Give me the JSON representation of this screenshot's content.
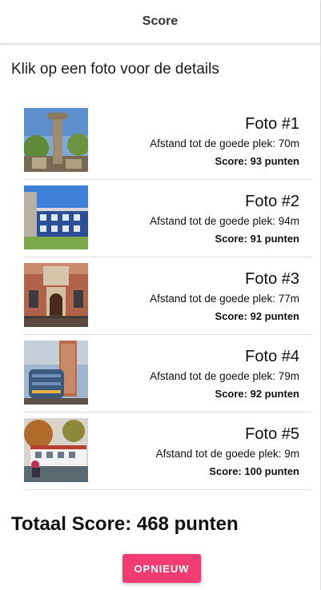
{
  "header": {
    "title": "Score"
  },
  "intro": "Klik op een foto voor de details",
  "photos": [
    {
      "title": "Foto #1",
      "distance": "Afstand tot de goede plek: 70m",
      "score": "Score: 93 punten",
      "thumb_icon": "statue-photo"
    },
    {
      "title": "Foto #2",
      "distance": "Afstand tot de goede plek: 94m",
      "score": "Score: 91 punten",
      "thumb_icon": "blue-building-photo"
    },
    {
      "title": "Foto #3",
      "distance": "Afstand tot de goede plek: 77m",
      "score": "Score: 92 punten",
      "thumb_icon": "brick-facade-photo"
    },
    {
      "title": "Foto #4",
      "distance": "Afstand tot de goede plek: 79m",
      "score": "Score: 92 punten",
      "thumb_icon": "glass-tower-photo"
    },
    {
      "title": "Foto #5",
      "distance": "Afstand tot de goede plek: 9m",
      "score": "Score: 100 punten",
      "thumb_icon": "houseboat-photo"
    }
  ],
  "total": "Totaal Score: 468 punten",
  "restart_label": "OPNIEUW",
  "colors": {
    "accent": "#f03c72",
    "divider": "#dcdcdc"
  }
}
